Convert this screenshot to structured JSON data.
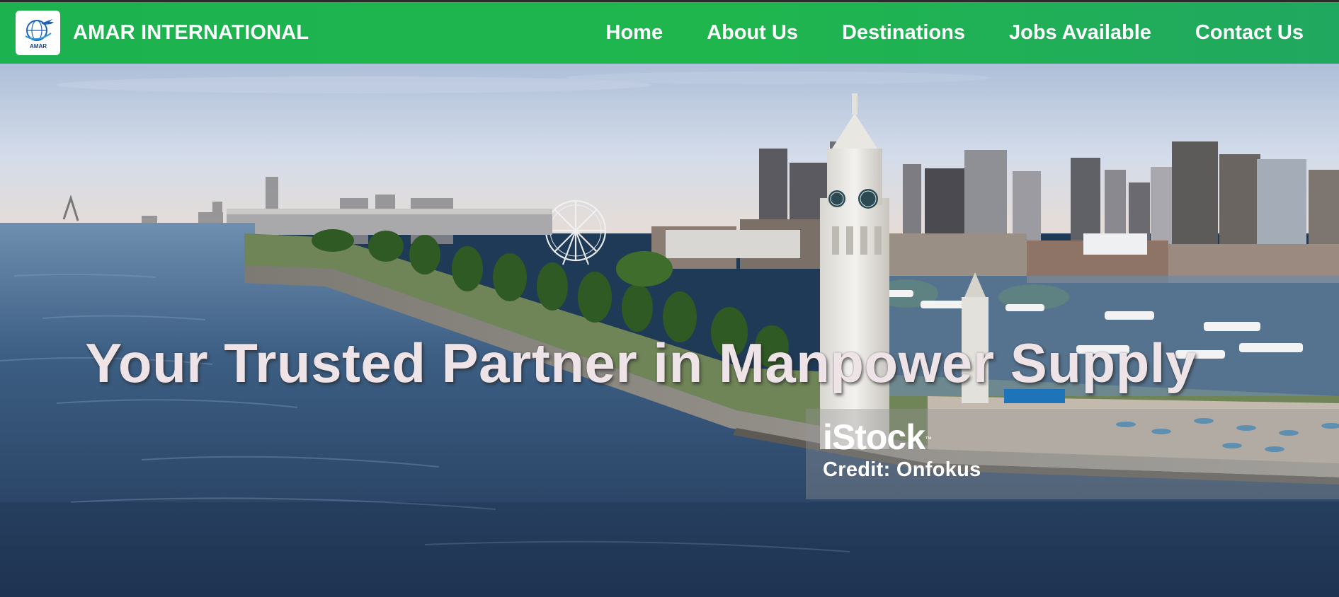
{
  "brand": {
    "name": "AMAR INTERNATIONAL",
    "logo_icon": "globe-airplane-logo",
    "logo_text": "AMAR"
  },
  "nav": {
    "items": [
      {
        "label": "Home"
      },
      {
        "label": "About Us"
      },
      {
        "label": "Destinations"
      },
      {
        "label": "Jobs Available"
      },
      {
        "label": "Contact Us"
      }
    ]
  },
  "hero": {
    "headline": "Your Trusted Partner in Manpower Supply",
    "watermark_brand": "iStock",
    "watermark_tm": "™",
    "watermark_credit": "Credit: Onfokus"
  },
  "colors": {
    "navbar": "#1cb24f",
    "nav_text": "#ffffff",
    "headline": "#eee4e7",
    "water": "#2c4a6c",
    "sky": "#c9d6e8"
  }
}
